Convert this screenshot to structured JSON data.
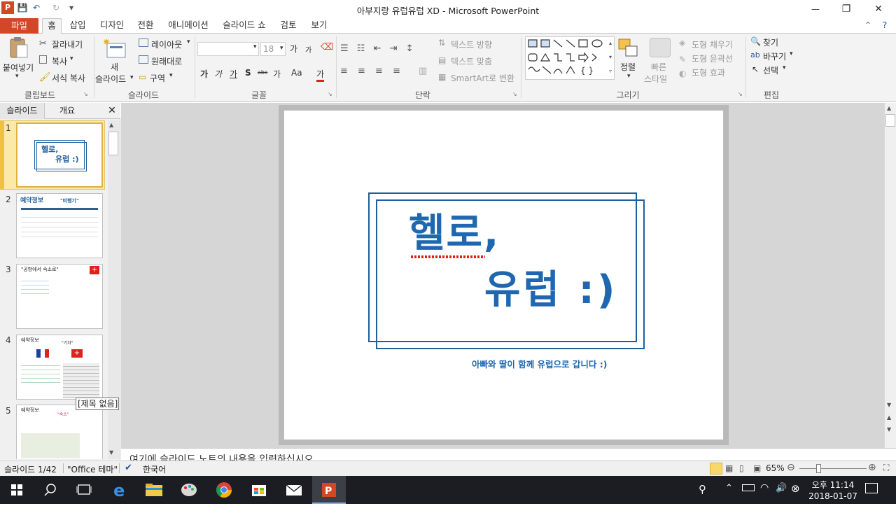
{
  "window": {
    "title": "아부지랑 유럽유럽 XD  -  Microsoft PowerPoint",
    "minimize_glyph": "—",
    "restore_glyph": "❐",
    "close_glyph": "✕"
  },
  "qat": {
    "save": "💾",
    "undo": "↶",
    "redo": "↻",
    "customize": "▾"
  },
  "tabs": [
    "파일",
    "홈",
    "삽입",
    "디자인",
    "전환",
    "애니메이션",
    "슬라이드 쇼",
    "검토",
    "보기"
  ],
  "ribbon": {
    "clipboard": {
      "paste": "붙여넣기",
      "cut": "잘라내기",
      "copy": "복사",
      "format_painter": "서식 복사",
      "group": "클립보드"
    },
    "slides": {
      "new_slide_1": "새",
      "new_slide_2": "슬라이드",
      "layout": "레이아웃",
      "reset": "원래대로",
      "section": "구역",
      "group": "슬라이드"
    },
    "font": {
      "size": "18",
      "group": "글꼴",
      "grow": "가",
      "shrink": "가",
      "bold": "가",
      "italic": "가",
      "underline": "가",
      "strike": "S",
      "spacing": "abc",
      "case": "가",
      "change_case": "Aa",
      "color": "가"
    },
    "paragraph": {
      "text_direction": "텍스트 방향",
      "align_text": "텍스트 맞춤",
      "smartart": "SmartArt로 변환",
      "group": "단락"
    },
    "drawing": {
      "arrange": "정렬",
      "quick_styles_1": "빠른",
      "quick_styles_2": "스타일",
      "fill": "도형 채우기",
      "outline": "도형 윤곽선",
      "effects": "도형 효과",
      "group": "그리기"
    },
    "editing": {
      "find": "찾기",
      "replace": "바꾸기",
      "select": "선택",
      "group": "편집"
    }
  },
  "left_pane": {
    "tab_slides": "슬라이드",
    "tab_outline": "개요",
    "close": "✕",
    "slide_numbers": [
      "1",
      "2",
      "3",
      "4",
      "5"
    ],
    "tooltip": "[제목 없음]",
    "thumb1": {
      "line1": "헬로,",
      "line2": "유럽 :)"
    },
    "thumb2": {
      "title": "예약정보",
      "quote": "\"비행기\""
    },
    "thumb3": {
      "title": "\"공항에서 숙소로\""
    },
    "thumb4": {
      "title": "예약정보",
      "quote": "\"기차\""
    },
    "thumb5": {
      "title": "예약정보",
      "quote": "\"숙소\""
    }
  },
  "slide": {
    "title_line1": "헬로,",
    "title_line2": "유럽 :)",
    "subtitle": "아빠와 딸이 함께 유럽으로 갑니다 :)"
  },
  "notes": {
    "placeholder": "여기에 슬라이드 노트의 내용을 입력하십시오."
  },
  "status": {
    "slide_info": "슬라이드 1/42",
    "theme": "\"Office 테마\"",
    "language": "한국어",
    "zoom": "65%"
  },
  "taskbar": {
    "time": "오후 11:14",
    "date": "2018-01-07"
  },
  "colors": {
    "accent_blue": "#1f5f9f",
    "file_tab": "#d24726",
    "ppt_orange": "#d24726"
  }
}
